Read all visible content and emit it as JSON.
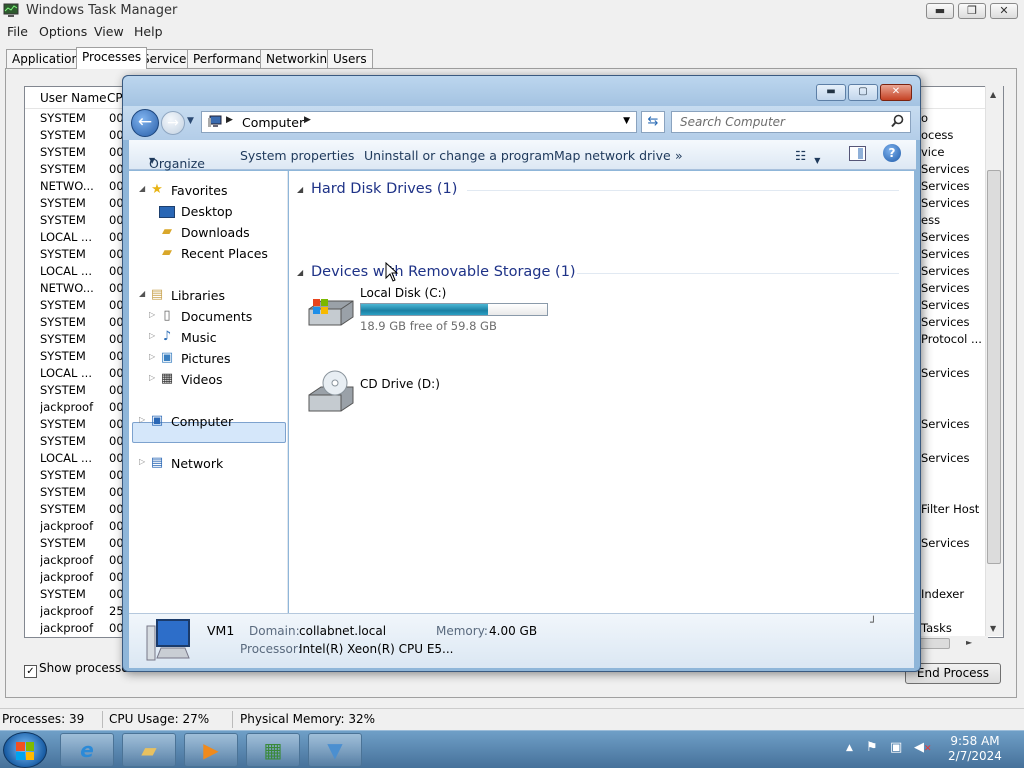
{
  "task_manager": {
    "title": "Windows Task Manager",
    "menu": [
      "File",
      "Options",
      "View",
      "Help"
    ],
    "tabs": [
      "Applications",
      "Processes",
      "Services",
      "Performance",
      "Networking",
      "Users"
    ],
    "active_tab": "Processes",
    "columns": {
      "user": "User Name",
      "cpu": "CPU"
    },
    "rows": [
      {
        "user": "SYSTEM",
        "cpu": "00",
        "desc": "o"
      },
      {
        "user": "SYSTEM",
        "cpu": "00",
        "desc": "ocess"
      },
      {
        "user": "SYSTEM",
        "cpu": "00",
        "desc": "vice"
      },
      {
        "user": "SYSTEM",
        "cpu": "00",
        "desc": "Services"
      },
      {
        "user": "NETWO...",
        "cpu": "00",
        "desc": "Services"
      },
      {
        "user": "SYSTEM",
        "cpu": "00",
        "desc": "Services"
      },
      {
        "user": "SYSTEM",
        "cpu": "00",
        "desc": "ess"
      },
      {
        "user": "LOCAL ...",
        "cpu": "00",
        "desc": "Services"
      },
      {
        "user": "SYSTEM",
        "cpu": "00",
        "desc": "Services"
      },
      {
        "user": "LOCAL ...",
        "cpu": "00",
        "desc": "Services"
      },
      {
        "user": "NETWO...",
        "cpu": "00",
        "desc": "Services"
      },
      {
        "user": "SYSTEM",
        "cpu": "00",
        "desc": "Services"
      },
      {
        "user": "SYSTEM",
        "cpu": "00",
        "desc": "Services"
      },
      {
        "user": "SYSTEM",
        "cpu": "00",
        "desc": "Protocol ..."
      },
      {
        "user": "SYSTEM",
        "cpu": "00",
        "desc": ""
      },
      {
        "user": "LOCAL ...",
        "cpu": "00",
        "desc": "Services"
      },
      {
        "user": "SYSTEM",
        "cpu": "00",
        "desc": ""
      },
      {
        "user": "jackproof",
        "cpu": "00",
        "desc": ""
      },
      {
        "user": "SYSTEM",
        "cpu": "00",
        "desc": "Services"
      },
      {
        "user": "SYSTEM",
        "cpu": "00",
        "desc": ""
      },
      {
        "user": "LOCAL ...",
        "cpu": "00",
        "desc": "Services"
      },
      {
        "user": "SYSTEM",
        "cpu": "00",
        "desc": ""
      },
      {
        "user": "SYSTEM",
        "cpu": "00",
        "desc": ""
      },
      {
        "user": "SYSTEM",
        "cpu": "00",
        "desc": "Filter Host"
      },
      {
        "user": "jackproof",
        "cpu": "00",
        "desc": ""
      },
      {
        "user": "SYSTEM",
        "cpu": "00",
        "desc": "Services"
      },
      {
        "user": "jackproof",
        "cpu": "00",
        "desc": ""
      },
      {
        "user": "jackproof",
        "cpu": "00",
        "desc": ""
      },
      {
        "user": "SYSTEM",
        "cpu": "00",
        "desc": "Indexer"
      },
      {
        "user": "jackproof",
        "cpu": "25",
        "desc": ""
      },
      {
        "user": "jackproof",
        "cpu": "00",
        "desc": "Tasks"
      }
    ],
    "show_all_label": "Show processes f",
    "show_all_checked": true,
    "end_process_label": "End Process",
    "status": {
      "processes": "Processes: 39",
      "cpu": "CPU Usage: 27%",
      "memory": "Physical Memory: 32%"
    }
  },
  "explorer": {
    "address": "Computer",
    "search_placeholder": "Search Computer",
    "toolbar": [
      "Organize",
      "System properties",
      "Uninstall or change a program",
      "Map network drive"
    ],
    "more": "»",
    "nav": {
      "favorites": "Favorites",
      "desktop": "Desktop",
      "downloads": "Downloads",
      "recent": "Recent Places",
      "libraries": "Libraries",
      "documents": "Documents",
      "music": "Music",
      "pictures": "Pictures",
      "videos": "Videos",
      "computer": "Computer",
      "network": "Network"
    },
    "groups": {
      "hdd": "Hard Disk Drives (1)",
      "removable": "Devices with Removable Storage (1)"
    },
    "drive_c": {
      "name": "Local Disk (C:)",
      "free": "18.9 GB free of 59.8 GB",
      "used_fraction": 0.684
    },
    "drive_d": {
      "name": "CD Drive (D:)"
    },
    "details": {
      "name": "VM1",
      "domain_label": "Domain:",
      "domain": "collabnet.local",
      "memory_label": "Memory:",
      "memory": "4.00 GB",
      "processor_label": "Processor:",
      "processor": "Intel(R) Xeon(R) CPU E5..."
    }
  },
  "taskbar": {
    "time": "9:58 AM",
    "date": "2/7/2024"
  }
}
